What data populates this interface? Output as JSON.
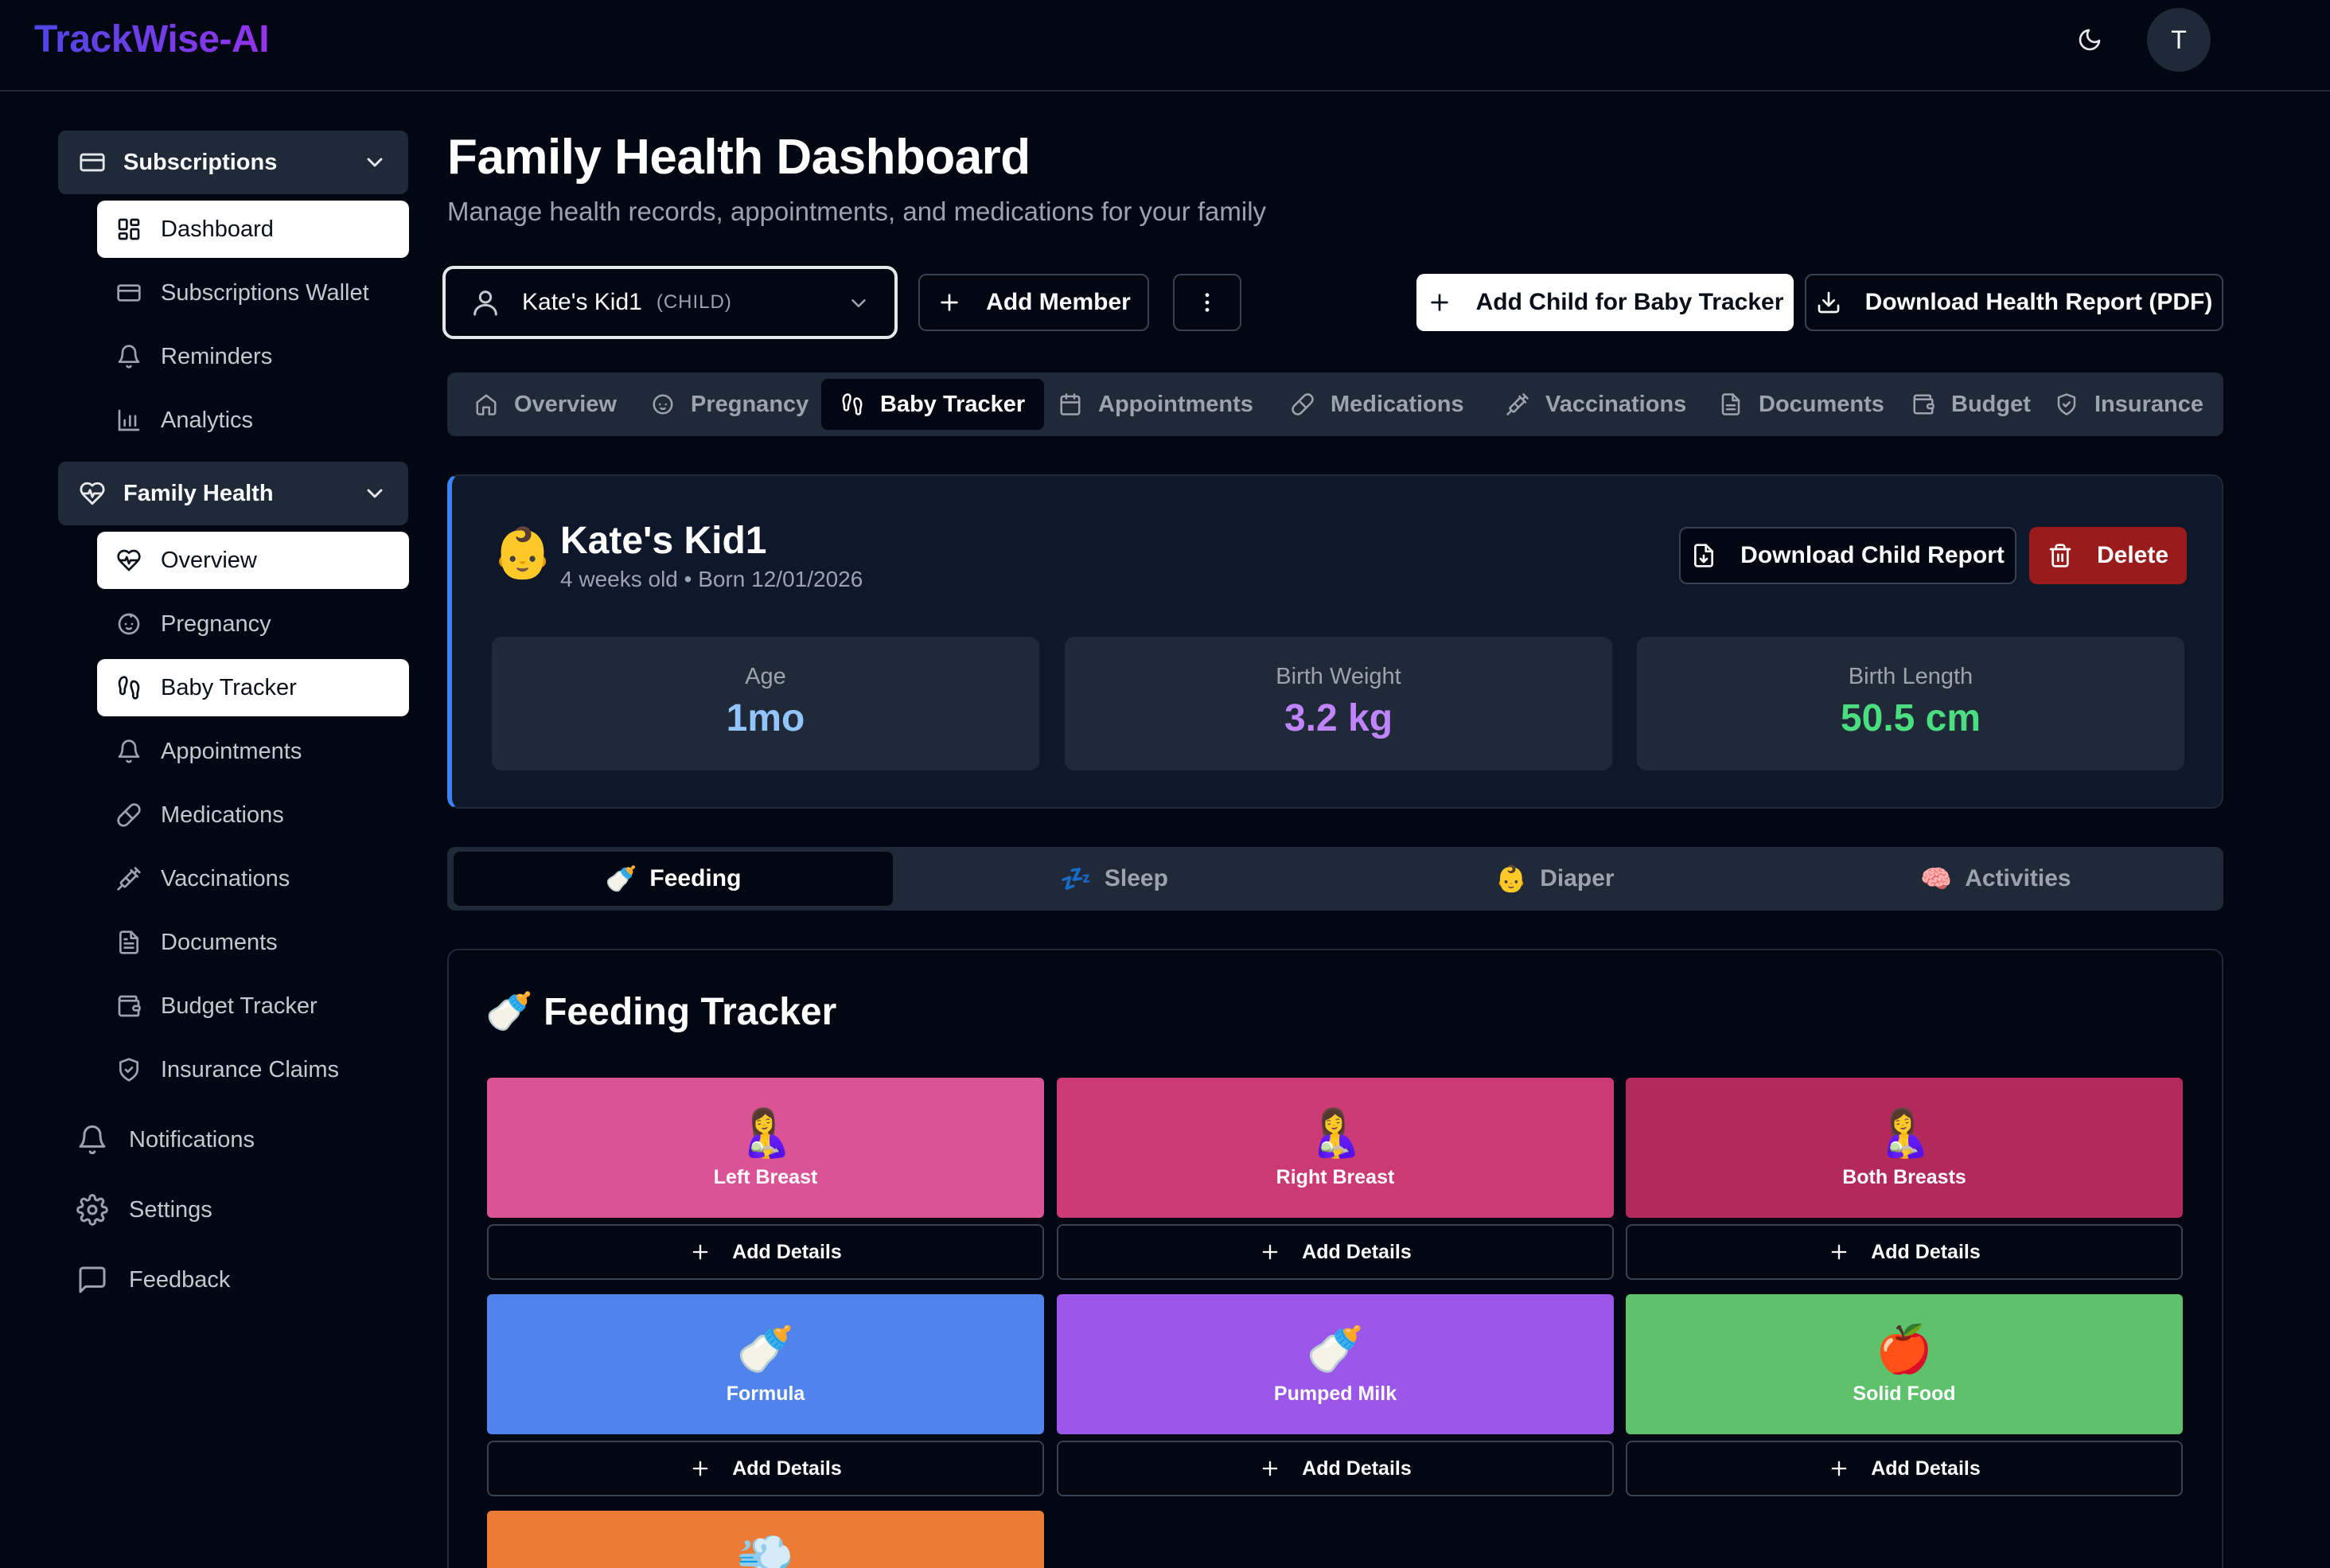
{
  "app": {
    "logo": "TrackWise-AI",
    "avatar_initial": "T"
  },
  "sidebar": {
    "groups": [
      {
        "label": "Subscriptions"
      },
      {
        "label": "Family Health"
      }
    ],
    "subscriptions_items": [
      {
        "label": "Dashboard",
        "icon": "grid-icon",
        "active": true
      },
      {
        "label": "Subscriptions Wallet",
        "icon": "card-icon"
      },
      {
        "label": "Reminders",
        "icon": "bell-icon"
      },
      {
        "label": "Analytics",
        "icon": "bar-chart-icon"
      }
    ],
    "health_items": [
      {
        "label": "Overview",
        "icon": "heart-pulse-icon",
        "active": true
      },
      {
        "label": "Pregnancy",
        "icon": "baby-face-icon"
      },
      {
        "label": "Baby Tracker",
        "icon": "footprints-icon",
        "active": true
      },
      {
        "label": "Appointments",
        "icon": "bell-icon"
      },
      {
        "label": "Medications",
        "icon": "pill-icon"
      },
      {
        "label": "Vaccinations",
        "icon": "syringe-icon"
      },
      {
        "label": "Documents",
        "icon": "document-icon"
      },
      {
        "label": "Budget Tracker",
        "icon": "wallet-icon"
      },
      {
        "label": "Insurance Claims",
        "icon": "shield-icon"
      }
    ],
    "footer_items": [
      {
        "label": "Notifications"
      },
      {
        "label": "Settings"
      },
      {
        "label": "Feedback"
      }
    ]
  },
  "header": {
    "title": "Family Health Dashboard",
    "subtitle": "Manage health records, appointments, and medications for your family"
  },
  "member_select": {
    "name": "Kate's Kid1",
    "tag": "(CHILD)"
  },
  "actions": {
    "add_member": "Add Member",
    "add_child": "Add Child for Baby Tracker",
    "download_report": "Download Health Report (PDF)"
  },
  "tabs": [
    "Overview",
    "Pregnancy",
    "Baby Tracker",
    "Appointments",
    "Medications",
    "Vaccinations",
    "Documents",
    "Budget",
    "Insurance"
  ],
  "active_tab": "Baby Tracker",
  "child": {
    "emoji": "👶",
    "name": "Kate's Kid1",
    "meta": "4 weeks old • Born 12/01/2026",
    "download_label": "Download Child Report",
    "delete_label": "Delete",
    "stats": [
      {
        "label": "Age",
        "value": "1mo",
        "color": "#93c5fd"
      },
      {
        "label": "Birth Weight",
        "value": "3.2 kg",
        "color": "#c084fc"
      },
      {
        "label": "Birth Length",
        "value": "50.5 cm",
        "color": "#4ade80"
      }
    ]
  },
  "subtabs": [
    {
      "emoji": "🍼",
      "label": "Feeding"
    },
    {
      "emoji": "💤",
      "label": "Sleep"
    },
    {
      "emoji": "👶",
      "label": "Diaper"
    },
    {
      "emoji": "🧠",
      "label": "Activities"
    }
  ],
  "tracker": {
    "title": "🍼 Feeding Tracker",
    "add_label": "Add Details",
    "cards": [
      {
        "emoji": "🤱",
        "label": "Left Breast",
        "color": "#db5397"
      },
      {
        "emoji": "🤱",
        "label": "Right Breast",
        "color": "#cc3a75"
      },
      {
        "emoji": "🤱",
        "label": "Both Breasts",
        "color": "#b3295b"
      },
      {
        "emoji": "🍼",
        "label": "Formula",
        "color": "#5084ec"
      },
      {
        "emoji": "🍼",
        "label": "Pumped Milk",
        "color": "#9a57ea"
      },
      {
        "emoji": "🍎",
        "label": "Solid Food",
        "color": "#5ec16c"
      },
      {
        "emoji": "💨",
        "label": "",
        "color": "#ec7c35"
      }
    ]
  }
}
